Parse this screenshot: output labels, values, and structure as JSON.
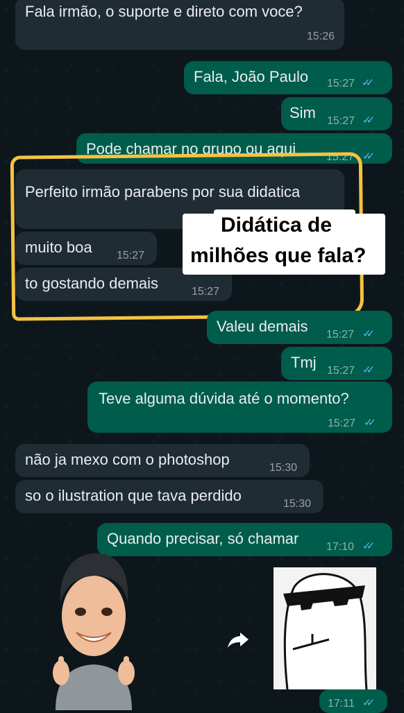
{
  "messages": [
    {
      "dir": "in",
      "text": "Fala irmão, o suporte e direto com voce?",
      "time": "15:26"
    },
    {
      "dir": "out",
      "text": "Fala, João Paulo",
      "time": "15:27"
    },
    {
      "dir": "out",
      "text": "Sim",
      "time": "15:27"
    },
    {
      "dir": "out",
      "text": "Pode chamar no grupo ou aqui",
      "time": "15:27"
    },
    {
      "dir": "in",
      "text": "Perfeito irmão parabens por sua didatica",
      "time": ""
    },
    {
      "dir": "in",
      "text": "muito boa",
      "time": "15:27"
    },
    {
      "dir": "in",
      "text": "to gostando demais",
      "time": "15:27"
    },
    {
      "dir": "out",
      "text": "Valeu demais",
      "time": "15:27"
    },
    {
      "dir": "out",
      "text": "Tmj",
      "time": "15:27"
    },
    {
      "dir": "out",
      "text": "Teve alguma dúvida até o momento?",
      "time": "15:27"
    },
    {
      "dir": "in",
      "text": "não ja mexo com o photoshop",
      "time": "15:30"
    },
    {
      "dir": "in",
      "text": "so o ilustration que tava perdido",
      "time": "15:30"
    },
    {
      "dir": "out",
      "text": "Quando precisar, só chamar",
      "time": "17:10"
    },
    {
      "dir": "out",
      "text": "",
      "time": "17:11"
    }
  ],
  "overlay": {
    "caption_line1": "Didática de",
    "caption_line2": "milhões que fala?",
    "highlight_color": "#f5c242"
  },
  "icons": {
    "read_ticks": "double-check-icon",
    "forward": "forward-arrow-icon"
  }
}
